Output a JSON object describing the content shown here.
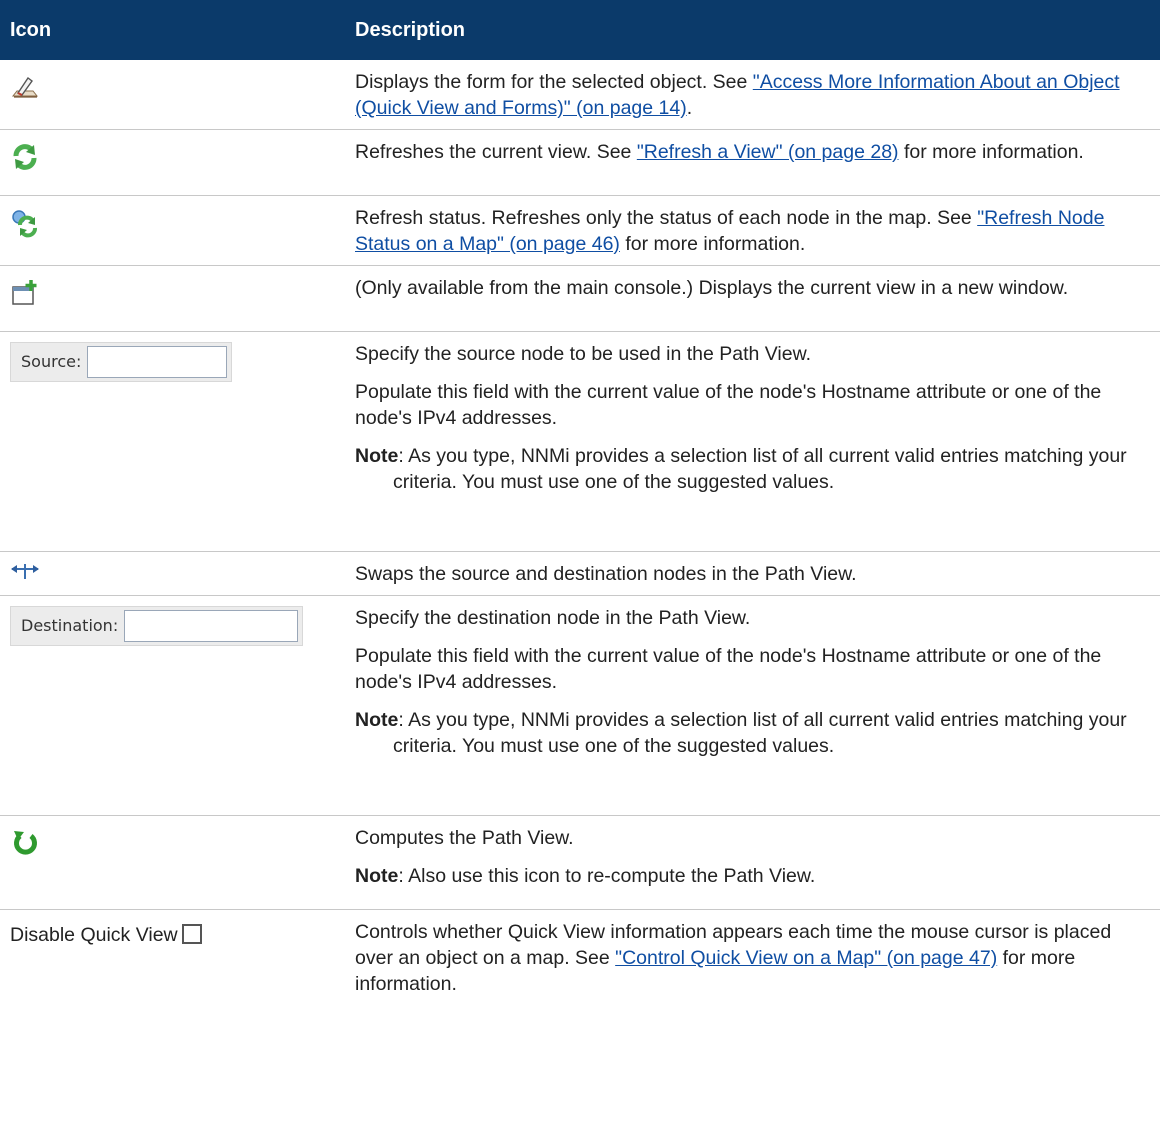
{
  "header": {
    "icon": "Icon",
    "description": "Description"
  },
  "rows": [
    {
      "icon_name": "form-pencil-icon",
      "text_before": "Displays the form for the selected object. See ",
      "link": "\"Access More Information About an Object (Quick View and Forms)\" (on page 14)",
      "text_after": "."
    },
    {
      "icon_name": "refresh-icon",
      "text_before": "Refreshes the current view. See ",
      "link": "\"Refresh a View\" (on page 28)",
      "text_after": " for more information."
    },
    {
      "icon_name": "refresh-status-icon",
      "text_before": "Refresh status. Refreshes only the status of each node in the map. See ",
      "link": "\"Refresh Node Status on a Map\" (on page 46)",
      "text_after": " for more information."
    },
    {
      "icon_name": "new-window-icon",
      "text": "(Only available from the main console.) Displays the current view in a new window."
    },
    {
      "icon_name": "source-field",
      "widget_label": "Source:",
      "p1": "Specify the source node to be used in the Path View.",
      "p2": "Populate this field with the current value of the node's Hostname attribute or one of the node's IPv4 addresses.",
      "note_label": "Note",
      "note_text": ": As you type, NNMi provides a selection list of all current valid entries matching your criteria. You must use one of the suggested values."
    },
    {
      "icon_name": "swap-icon",
      "text": "Swaps the source and destination nodes in the Path View."
    },
    {
      "icon_name": "destination-field",
      "widget_label": "Destination:",
      "p1": "Specify the destination node in the Path View.",
      "p2": "Populate this field with the current value of the node's Hostname attribute or one of the node's IPv4 addresses.",
      "note_label": "Note",
      "note_text": ": As you type, NNMi provides a selection list of all current valid entries matching your criteria. You must use one of the suggested values."
    },
    {
      "icon_name": "compute-icon",
      "p1": "Computes the Path View.",
      "note_label": "Note",
      "note_text": ": Also use this icon to re-compute the Path View."
    },
    {
      "icon_name": "checkbox",
      "widget_label": "Disable Quick View",
      "text_before": "Controls whether Quick View information appears each time the mouse cursor is placed over an object on a map. See ",
      "link": "\"Control Quick View on a Map\" (on page 47)",
      "text_after": " for more information."
    }
  ],
  "colors": {
    "header_bg": "#0b3a6a",
    "link": "#0f4ea3",
    "text": "#222222"
  }
}
